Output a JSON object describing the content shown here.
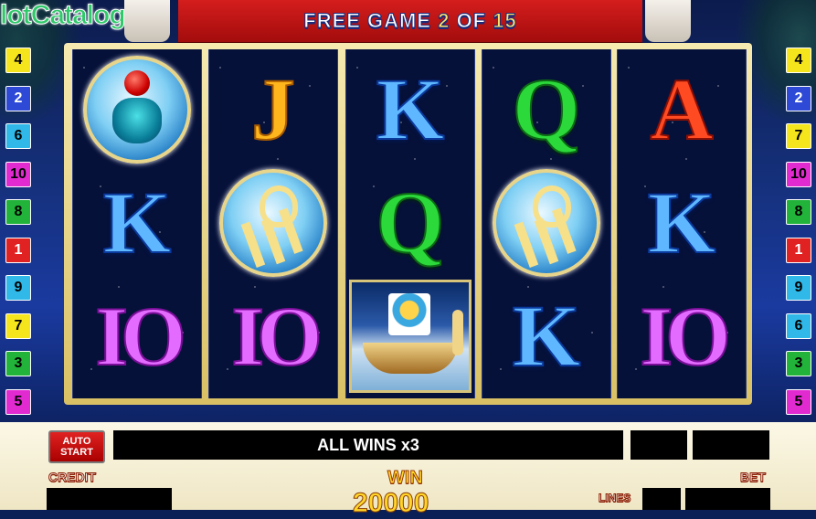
{
  "watermark": "lotCatalog",
  "banner": {
    "prefix": "FREE GAME",
    "current": "2",
    "of": "OF",
    "total": "15"
  },
  "badges_left": [
    {
      "n": "4",
      "color": "#f5e51c"
    },
    {
      "n": "2",
      "color": "#2d49d6"
    },
    {
      "n": "6",
      "color": "#2fb8e8"
    },
    {
      "n": "10",
      "color": "#e12bd1"
    },
    {
      "n": "8",
      "color": "#21b33a"
    },
    {
      "n": "1",
      "color": "#e12222"
    },
    {
      "n": "9",
      "color": "#2fb8e8"
    },
    {
      "n": "7",
      "color": "#f5e51c"
    },
    {
      "n": "3",
      "color": "#21b33a"
    },
    {
      "n": "5",
      "color": "#e12bd1"
    }
  ],
  "badges_right": [
    {
      "n": "4",
      "color": "#f5e51c"
    },
    {
      "n": "2",
      "color": "#2d49d6"
    },
    {
      "n": "7",
      "color": "#f5e51c"
    },
    {
      "n": "10",
      "color": "#e12bd1"
    },
    {
      "n": "8",
      "color": "#21b33a"
    },
    {
      "n": "1",
      "color": "#e12222"
    },
    {
      "n": "9",
      "color": "#2fb8e8"
    },
    {
      "n": "6",
      "color": "#2fb8e8"
    },
    {
      "n": "3",
      "color": "#21b33a"
    },
    {
      "n": "5",
      "color": "#e12bd1"
    }
  ],
  "reels": [
    [
      "scarab",
      "K",
      "10"
    ],
    [
      "J",
      "ankh",
      "10"
    ],
    [
      "K",
      "Q",
      "ship"
    ],
    [
      "Q",
      "ankh",
      "K"
    ],
    [
      "A",
      "K",
      "10"
    ]
  ],
  "symbols": {
    "K": "K",
    "Q": "Q",
    "J": "J",
    "A": "A",
    "10": "IO"
  },
  "controls": {
    "autostart_line1": "AUTO",
    "autostart_line2": "START",
    "message": "ALL WINS x3",
    "credit_label": "CREDIT",
    "win_label": "WIN",
    "win_value": "20000",
    "lines_label": "LINES",
    "bet_label": "BET"
  }
}
